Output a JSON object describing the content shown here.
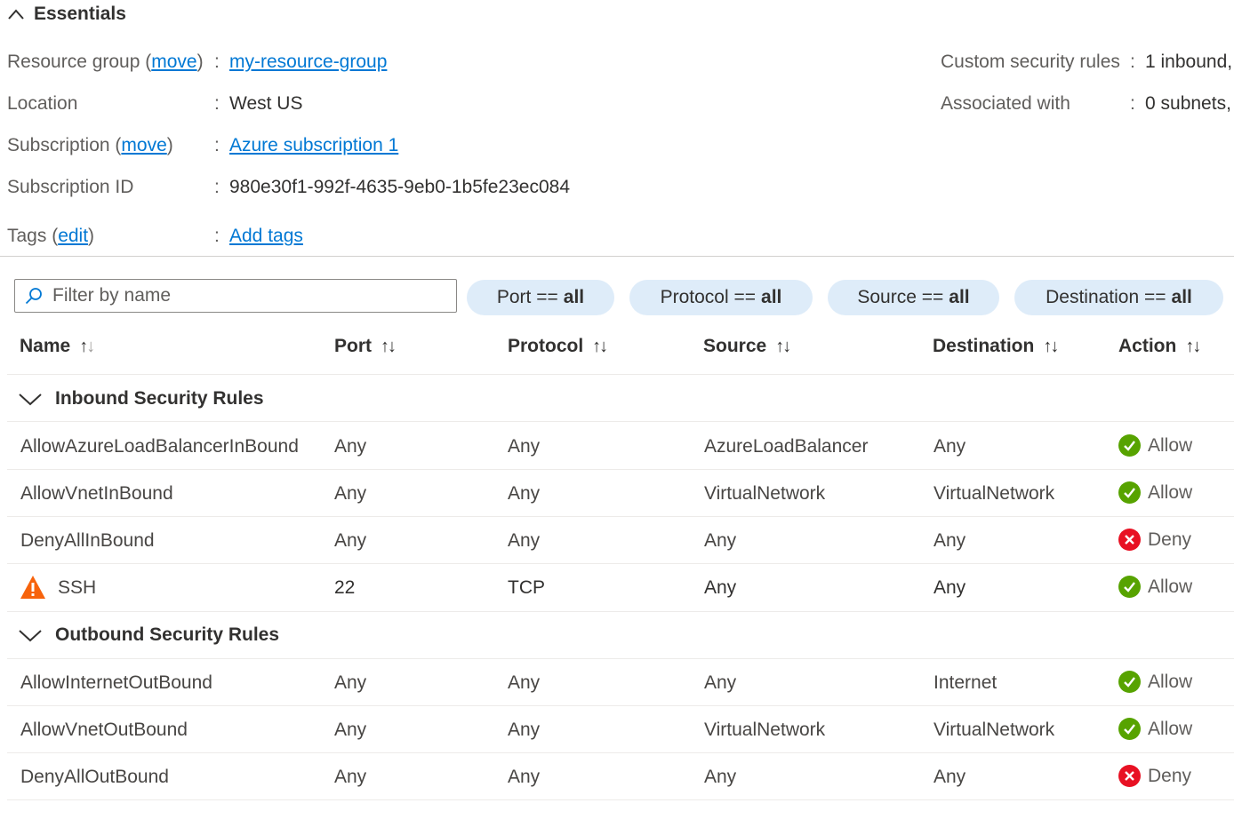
{
  "essentials": {
    "title": "Essentials",
    "resource_group": {
      "label": "Resource group",
      "move": "move",
      "value": "my-resource-group"
    },
    "location": {
      "label": "Location",
      "value": "West US"
    },
    "subscription": {
      "label": "Subscription",
      "move": "move",
      "value": "Azure subscription 1"
    },
    "subscription_id": {
      "label": "Subscription ID",
      "value": "980e30f1-992f-4635-9eb0-1b5fe23ec084"
    },
    "tags": {
      "label": "Tags",
      "edit": "edit",
      "value": "Add tags"
    },
    "custom_rules": {
      "label": "Custom security rules",
      "value": "1 inbound,"
    },
    "associated": {
      "label": "Associated with",
      "value": "0 subnets,"
    }
  },
  "filter": {
    "placeholder": "Filter by name",
    "pills": [
      {
        "label": "Port ==",
        "value": "all"
      },
      {
        "label": "Protocol ==",
        "value": "all"
      },
      {
        "label": "Source ==",
        "value": "all"
      },
      {
        "label": "Destination ==",
        "value": "all"
      }
    ]
  },
  "table": {
    "columns": [
      "Name",
      "Port",
      "Protocol",
      "Source",
      "Destination",
      "Action"
    ],
    "inbound_title": "Inbound Security Rules",
    "outbound_title": "Outbound Security Rules",
    "inbound": [
      {
        "name": "AllowAzureLoadBalancerInBound",
        "port": "Any",
        "protocol": "Any",
        "source": "AzureLoadBalancer",
        "destination": "Any",
        "action": "Allow"
      },
      {
        "name": "AllowVnetInBound",
        "port": "Any",
        "protocol": "Any",
        "source": "VirtualNetwork",
        "destination": "VirtualNetwork",
        "action": "Allow"
      },
      {
        "name": "DenyAllInBound",
        "port": "Any",
        "protocol": "Any",
        "source": "Any",
        "destination": "Any",
        "action": "Deny"
      },
      {
        "name": "SSH",
        "port": "22",
        "protocol": "TCP",
        "source": "Any",
        "destination": "Any",
        "action": "Allow"
      }
    ],
    "outbound": [
      {
        "name": "AllowInternetOutBound",
        "port": "Any",
        "protocol": "Any",
        "source": "Any",
        "destination": "Internet",
        "action": "Allow"
      },
      {
        "name": "AllowVnetOutBound",
        "port": "Any",
        "protocol": "Any",
        "source": "VirtualNetwork",
        "destination": "VirtualNetwork",
        "action": "Allow"
      },
      {
        "name": "DenyAllOutBound",
        "port": "Any",
        "protocol": "Any",
        "source": "Any",
        "destination": "Any",
        "action": "Deny"
      }
    ]
  },
  "colors": {
    "link": "#0078d4",
    "allow": "#57a300",
    "deny": "#e81123",
    "warning": "#f7630c",
    "pill_bg": "#deecf9"
  }
}
